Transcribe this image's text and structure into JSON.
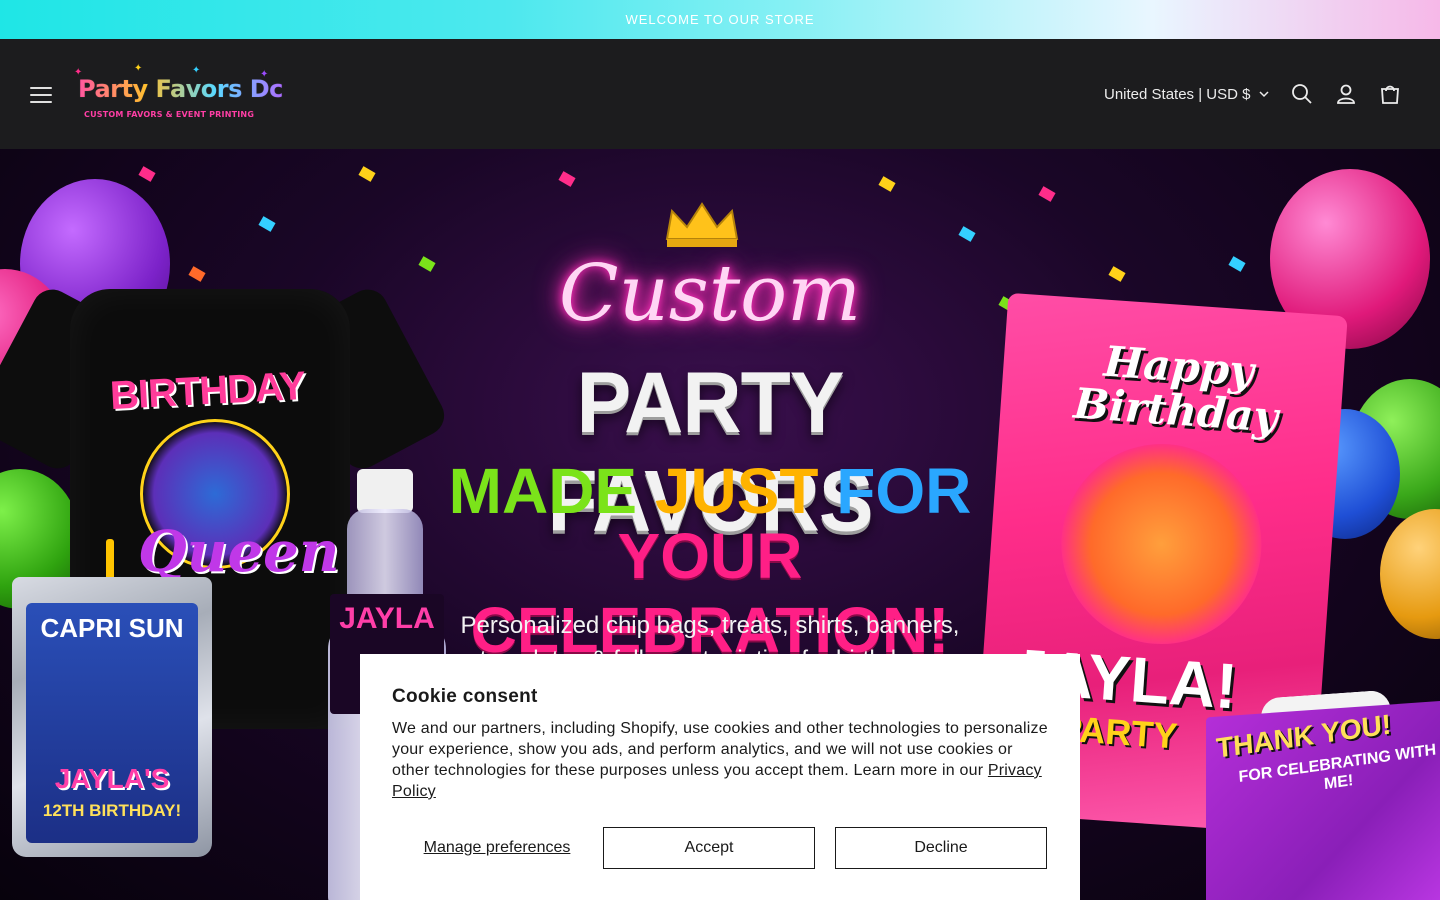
{
  "announcement": {
    "text": "WELCOME TO OUR STORE"
  },
  "header": {
    "logo": {
      "name": "Party Favors Dc",
      "tagline": "CUSTOM FAVORS & EVENT PRINTING"
    },
    "country_selector": {
      "label": "United States | USD $"
    },
    "icons": [
      "menu-icon",
      "search-icon",
      "account-icon",
      "cart-icon"
    ]
  },
  "hero": {
    "script": "Custom",
    "line1": "PARTY FAVORS",
    "line2": {
      "w1": "MADE",
      "w2": "JUST",
      "w3": "FOR"
    },
    "line3": "YOUR CELEBRATION!",
    "description": "Personalized chip bags, treats, shirts, banners, templates & full event printing for birthdays, graduations, weddings",
    "products": {
      "shirt_top": "BIRTHDAY",
      "shirt_bottom": "Queen",
      "pouch_brand": "CAPRI SUN",
      "pouch_name": "JAYLA'S",
      "pouch_subtitle": "12TH BIRTHDAY!",
      "bottle_name": "JAYLA",
      "chip_happy": "Happy Birthday",
      "chip_name": "JAYLA!",
      "chip_party": "PARTY",
      "gift_thanks": "THANK YOU!",
      "gift_sub": "FOR CELEBRATING WITH ME!"
    }
  },
  "cookie": {
    "title": "Cookie consent",
    "body": "We and our partners, including Shopify, use cookies and other technologies to personalize your experience, show you ads, and perform analytics, and we will not use cookies or other technologies for these purposes unless you accept them. Learn more in our",
    "link": "Privacy Policy",
    "manage": "Manage preferences",
    "accept": "Accept",
    "decline": "Decline"
  },
  "colors": {
    "header_bg": "#1c1c1e",
    "accent_pink": "#ff2d8a",
    "modal_bg": "#ffffff"
  }
}
